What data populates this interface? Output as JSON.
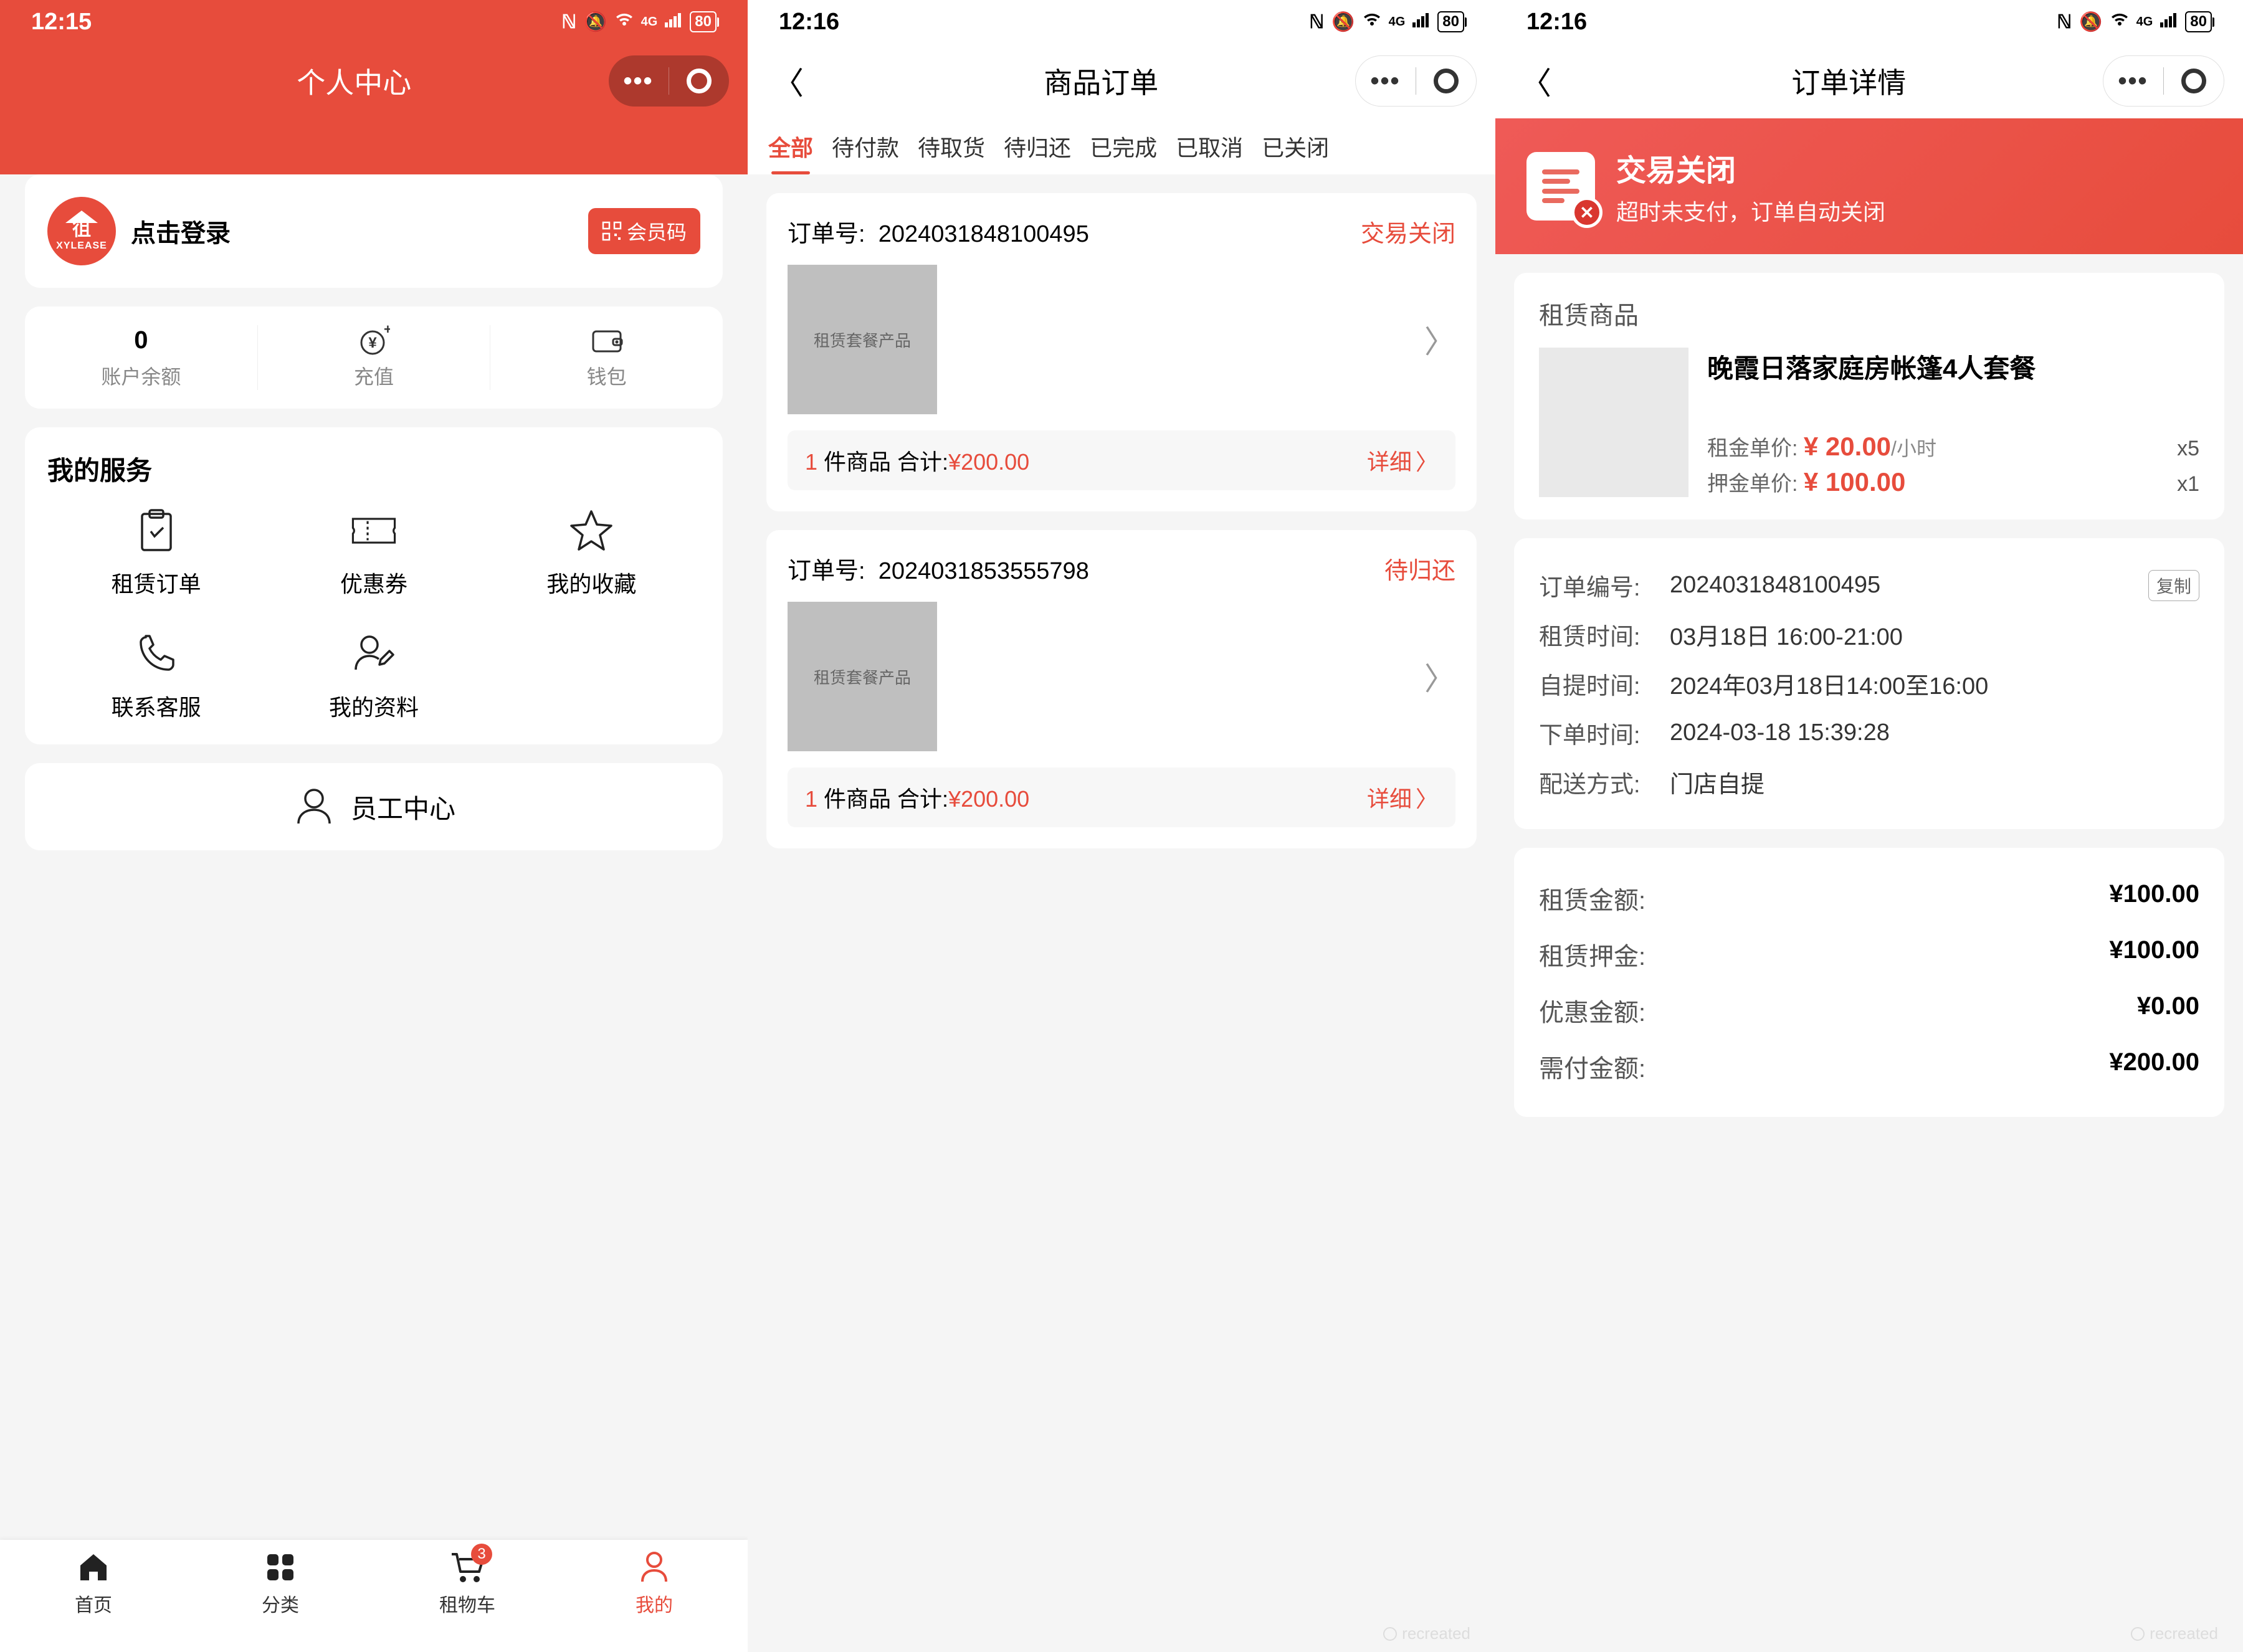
{
  "screen1": {
    "status_time": "12:15",
    "battery": "80",
    "header_title": "个人中心",
    "avatar_brand": "XYLEASE",
    "login_prompt": "点击登录",
    "member_code_label": "会员码",
    "balance_value": "0",
    "balance_label": "账户余额",
    "recharge_label": "充值",
    "wallet_label": "钱包",
    "services_title": "我的服务",
    "services": {
      "rental_orders": "租赁订单",
      "coupons": "优惠券",
      "favorites": "我的收藏",
      "contact_cs": "联系客服",
      "my_profile": "我的资料"
    },
    "staff_center": "员工中心",
    "tabs": {
      "home": "首页",
      "category": "分类",
      "cart": "租物车",
      "mine": "我的",
      "cart_badge": "3"
    }
  },
  "screen2": {
    "status_time": "12:16",
    "battery": "80",
    "header_title": "商品订单",
    "filters": {
      "all": "全部",
      "pending_pay": "待付款",
      "pending_pickup": "待取货",
      "pending_return": "待归还",
      "completed": "已完成",
      "cancelled": "已取消",
      "closed": "已关闭"
    },
    "order_no_label": "订单号:",
    "thumb_text": "租赁套餐产品",
    "summary_prefix_count": "1",
    "summary_middle": "件商品 合计:",
    "summary_amount": "¥200.00",
    "detail_label": "详细",
    "orders": [
      {
        "no": "2024031848100495",
        "status": "交易关闭"
      },
      {
        "no": "2024031853555798",
        "status": "待归还"
      }
    ]
  },
  "screen3": {
    "status_time": "12:16",
    "battery": "80",
    "header_title": "订单详情",
    "banner_title": "交易关闭",
    "banner_sub": "超时未支付，订单自动关闭",
    "section_rental_title": "租赁商品",
    "product_name": "晚霞日落家庭房帐篷4人套餐",
    "rent_label": "租金单价:",
    "rent_price": "¥ 20.00",
    "rent_unit": "/小时",
    "rent_qty": "x5",
    "deposit_label": "押金单价:",
    "deposit_price": "¥ 100.00",
    "deposit_qty": "x1",
    "copy_label": "复制",
    "details": {
      "order_no_k": "订单编号:",
      "order_no_v": "2024031848100495",
      "rental_time_k": "租赁时间:",
      "rental_time_v": "03月18日 16:00-21:00",
      "pickup_time_k": "自提时间:",
      "pickup_time_v": "2024年03月18日14:00至16:00",
      "order_time_k": "下单时间:",
      "order_time_v": "2024-03-18 15:39:28",
      "delivery_k": "配送方式:",
      "delivery_v": "门店自提"
    },
    "money": {
      "rent_k": "租赁金额:",
      "rent_v": "¥100.00",
      "deposit_k": "租赁押金:",
      "deposit_v": "¥100.00",
      "discount_k": "优惠金额:",
      "discount_v": "¥0.00",
      "payable_k": "需付金额:",
      "payable_v": "¥200.00"
    }
  }
}
